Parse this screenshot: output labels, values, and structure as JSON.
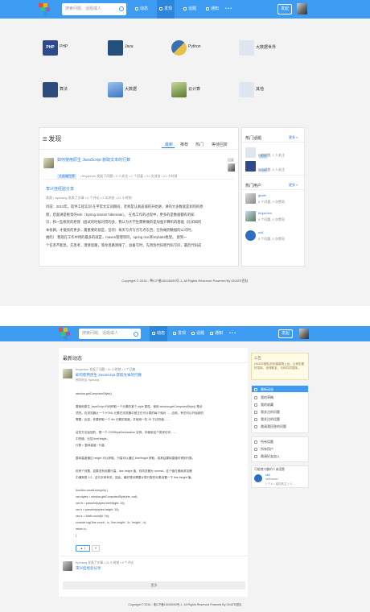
{
  "nav": {
    "search_placeholder": "搜索问题、话题或人",
    "items": [
      {
        "label": "动态"
      },
      {
        "label": "发现"
      },
      {
        "label": "话题"
      },
      {
        "label": "通知"
      }
    ],
    "more": "• • •",
    "ask_label": "发起",
    "brand_colors": {
      "bar": "#3d9bf2",
      "active": "#2b86dc"
    }
  },
  "categories": [
    {
      "label": "PHP",
      "icon": "php-logo",
      "color": "#2f4a8c"
    },
    {
      "label": "Java",
      "icon": "java-logo",
      "color": "#234f7a"
    },
    {
      "label": "Python",
      "icon": "python-logo",
      "color": "#e8c04a"
    },
    {
      "label": "大数据世界",
      "icon": "bigdata-logo",
      "color": "#4a6a9a"
    },
    {
      "label": "算法",
      "icon": "algorithm-image",
      "color": "#2c4c7c"
    },
    {
      "label": "大数据",
      "icon": "bigdata-image",
      "color": "#5a8ad0"
    },
    {
      "label": "云计算",
      "icon": "cloud-image",
      "color": "#6a8a3a"
    },
    {
      "label": "其他",
      "icon": "other-image",
      "color": "#8aa0b8"
    }
  ],
  "discover": {
    "title": "发现",
    "tabs": [
      "最新",
      "推荐",
      "热门",
      "等待回复"
    ],
    "active_tab": "最新",
    "posts": [
      {
        "title": "如何使用原生 JavaScript 获取文本的行数",
        "tag": "大前端世界",
        "meta": "• fevjachen 发起了问题 • 2 人关注 • 1 个回复 • 21 次浏览 • 21 小时前",
        "side_label": "回复"
      },
      {
        "title": "李兴挂经验分享",
        "meta": "其他 • fiyzhang 发表了文章 • 0 个评论 • 2 次浏览 • 21 小时前",
        "body": [
          "目前：2013年，软件工程实训 在平常文实训期间，老师是认真盖城的开始讲，讲的大多数就是如何的原",
          "理，后面讲是框架的ssh（Spring struts2 hibernate）。        在找工作的过程中，更多的是数据都有的知",
          "识，和一些框架的原理（面试的时候问得的多，我认为大学生需要做的是加强计算机的基础（比如如何",
          "本找网，才能找的更多，最重要的就是，坚持）每天写点写点写点东西，在你做到数据的公司时，",
          "她的）    我现在工作中用的最多的就是，maven管理项目，spring mvc和mybatis框架。    接到一",
          "个任务不能急，先思考，理清思路，等你思路清晰了，准备写时，先用伪代码把代码写好，最后代码成"
        ]
      }
    ]
  },
  "hot_topics": {
    "title": "热门话题",
    "more": "更多 »",
    "items": [
      {
        "tag": "其他",
        "stats": "0 个问题, 1 人关注"
      },
      {
        "tag": "PHP",
        "stats": "0 个问题, 3 人关注"
      }
    ]
  },
  "hot_users": {
    "title": "热门用户",
    "more": "更多 »",
    "items": [
      {
        "name": "gkate",
        "stats": "0 个问题, 0 次赞同"
      },
      {
        "name": "fevjachen",
        "stats": "0 个问题, 0 次赞同"
      },
      {
        "name": "sk8",
        "stats": "0 个问题, 0 次赞同"
      }
    ]
  },
  "footer": "Copyright © 2016 - 粤ICP备15026090号-1, All Rights Reserved Powered By GKATE团队",
  "feed": {
    "title": "最新动态",
    "item1_meta": "fevjachen 发起了问题 • 21 小时前 • 1 个回复",
    "item1_title": "如何使用原生 JavaScript 获取文本的行数",
    "item1_tag": "赞同来自: fiyzhang",
    "code_lines": [
      "window.getComputedStyle()",
      "",
      "要使用原生 JavaScript 代码获取一个元素的某个 style 属性，使用 window.getComputedStyle() 是必",
      "须的。在浏览器从一个 HTML 元素在浏览器中被正在可计算的每个相对……应用，有些可以开始到的",
      "需要，比如，你要获取一个 div 元素的宽度。并使用一些 JS 方法的值……",
      "",
      "这些方法返回的，是一个 CSSStyleDeclaration 实例，你使用这个类来访问……",
      "中的值，比如 lineHeight。",
      "行数 = 整体高度 / 行高",
      "",
      "整体高度通过 height 可以获取，行高可以通过 lineHeight 获取，将其结果除整值可得到行数。",
      "",
      "但有个问题，如果没有设置行高，line-height 值，则浏览器为 normal，这个值在桌面浏览器",
      "中通常是 1.2，这与字体有关。因此，最好是对需要计算行数的元素设置一下 line-height 值。",
      "",
      "function countLines(ele) {",
      "  var styles = window.getComputedStyle(ele, null);",
      "  var lh = parseInt(styles.lineHeight, 10);",
      "  var h = parseInt(styles.height, 10);",
      "  var lc = Math.round(h / lh);",
      "  console.log('line count:', lc, 'line-height:', lh, 'height:', h);",
      "  return lc;",
      "}"
    ],
    "vote": "1",
    "item2_meta": "fiyzhang 发表了文章 • 21 小时前 • 0 个评论",
    "item2_title": "李兴挂经验分享",
    "more_button": "更多"
  },
  "notice": {
    "title": "公告",
    "body": "GKATE团队的价值观再上台，让你的更好发挥，全球职友，与你共同发挥。"
  },
  "menu": [
    "最新动态",
    "我的草稿",
    "我的收藏",
    "我关注的问题",
    "我关注的话题",
    "邀请我回答的问题",
    "所有话题",
    "所有用户",
    "邀请好友加入"
  ],
  "suggest": {
    "title": "可能感兴趣的人或话题",
    "name": "sk8",
    "desc": "skillmaster",
    "stats": "1 个人 • 结构关注 1 人"
  },
  "footer2": "Copyright © 2016 - 粤ICP备15026090号-1, All Rights Reserved Powered By GKATE团队"
}
